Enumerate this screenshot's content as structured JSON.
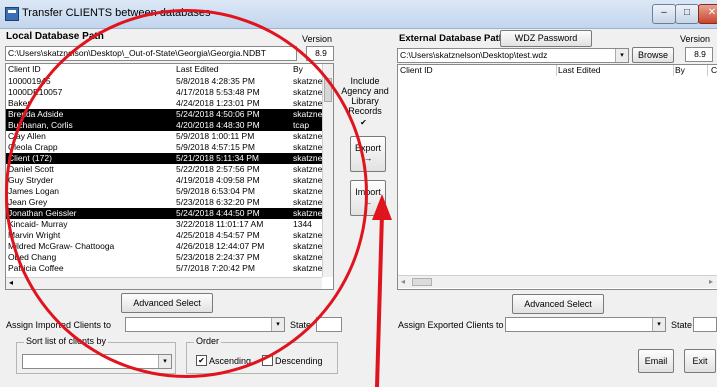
{
  "window": {
    "title": "Transfer CLIENTS between databases",
    "minimize": "–",
    "maximize": "□",
    "close": "✕"
  },
  "local": {
    "path_label": "Local Database Path",
    "version_label": "Version",
    "path_value": "C:\\Users\\skatznelson\\Desktop\\_Out-of-State\\Georgia\\Georgia.NDBT",
    "version_value": "8.9",
    "columns": [
      "Client ID",
      "Last Edited",
      "By"
    ],
    "rows": [
      {
        "id": "100001945",
        "edited": "5/8/2018 4:28:35 PM",
        "by": "skatznel",
        "selected": false
      },
      {
        "id": "1000DE10057",
        "edited": "4/17/2018 5:53:48 PM",
        "by": "skatznel",
        "selected": false
      },
      {
        "id": "Baker",
        "edited": "4/24/2018 1:23:01 PM",
        "by": "skatznel",
        "selected": false
      },
      {
        "id": "Brenda Adside",
        "edited": "5/24/2018 4:50:06 PM",
        "by": "skatznel",
        "selected": true
      },
      {
        "id": "Buchanan, Corlis",
        "edited": "4/20/2018 4:48:30 PM",
        "by": "tcap",
        "selected": true
      },
      {
        "id": "Clay Allen",
        "edited": "5/9/2018 1:00:11 PM",
        "by": "skatznel",
        "selected": false
      },
      {
        "id": "Cleola Crapp",
        "edited": "5/9/2018 4:57:15 PM",
        "by": "skatznel",
        "selected": false
      },
      {
        "id": "Client (172)",
        "edited": "5/21/2018 5:11:34 PM",
        "by": "skatznel",
        "selected": true
      },
      {
        "id": "Daniel Scott",
        "edited": "5/22/2018 2:57:56 PM",
        "by": "skatznel",
        "selected": false
      },
      {
        "id": "Guy Stryder",
        "edited": "4/19/2018 4:09:58 PM",
        "by": "skatznel",
        "selected": false
      },
      {
        "id": "James Logan",
        "edited": "5/9/2018 6:53:04 PM",
        "by": "skatznel",
        "selected": false
      },
      {
        "id": "Jean Grey",
        "edited": "5/23/2018 6:32:20 PM",
        "by": "skatznel",
        "selected": false
      },
      {
        "id": "Jonathan Geissler",
        "edited": "5/24/2018 4:44:50 PM",
        "by": "skatznel",
        "selected": true
      },
      {
        "id": "Kincaid- Murray",
        "edited": "3/22/2018 11:01:17 AM",
        "by": "1344",
        "selected": false
      },
      {
        "id": "Marvin Wright",
        "edited": "4/25/2018 4:54:57 PM",
        "by": "skatznel",
        "selected": false
      },
      {
        "id": "Mildred McGraw- Chattooga",
        "edited": "4/26/2018 12:44:07 PM",
        "by": "skatznel",
        "selected": false
      },
      {
        "id": "Obed Chang",
        "edited": "5/23/2018 2:24:37 PM",
        "by": "skatznel",
        "selected": false
      },
      {
        "id": "Patricia Coffee",
        "edited": "5/7/2018 7:20:42 PM",
        "by": "skatznel",
        "selected": false
      }
    ],
    "advanced_select": "Advanced Select",
    "assign_label": "Assign Imported Clients to",
    "state_label": "State",
    "sort_group": "Sort list of clients by",
    "order_group": "Order",
    "ascending": "Ascending",
    "descending": "Descending",
    "ascending_checked": "✔",
    "descending_checked": ""
  },
  "middle": {
    "include_label": "Include Agency and Library Records",
    "include_checked": "✔",
    "export_label": "Export",
    "export_arrow": "→",
    "import_label": "Import",
    "import_arrow": "←"
  },
  "external": {
    "path_label": "External Database Path",
    "wdz_button": "WDZ Password",
    "version_label": "Version",
    "path_value": "C:\\Users\\skatznelson\\Desktop\\test.wdz",
    "browse": "Browse",
    "version_value": "8.9",
    "columns": [
      "Client ID",
      "Last Edited",
      "By",
      "C"
    ],
    "advanced_select": "Advanced Select",
    "assign_label": "Assign Exported Clients to",
    "state_label": "State",
    "email": "Email",
    "exit": "Exit"
  },
  "annotation_colors": {
    "circle": "#e0141e",
    "arrow": "#e0141e"
  }
}
